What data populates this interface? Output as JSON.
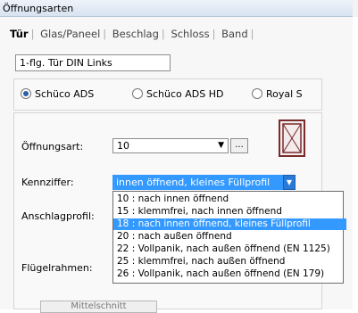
{
  "window": {
    "title": "Öffnungsarten"
  },
  "tabs": [
    {
      "label": "Tür",
      "active": true
    },
    {
      "label": "Glas/Paneel",
      "active": false
    },
    {
      "label": "Beschlag",
      "active": false
    },
    {
      "label": "Schloss",
      "active": false
    },
    {
      "label": "Band",
      "active": false
    }
  ],
  "door_type": {
    "value": "1-flg. Tür DIN Links"
  },
  "systems": [
    {
      "label": "Schüco ADS",
      "selected": true
    },
    {
      "label": "Schüco ADS HD",
      "selected": false
    },
    {
      "label": "Royal S",
      "selected": false
    }
  ],
  "form": {
    "oeffnungsart_label": "Öffnungsart:",
    "oeffnungsart_value": "10",
    "ellipsis_label": "...",
    "kennziffer_label": "Kennziffer:",
    "kennziffer_value": "innen öffnend, kleines Füllprofil",
    "anschlagprofil_label": "Anschlagprofil:",
    "fluegelrahmen_label": "Flügelrahmen:",
    "mittelschnitt_label": "Mittelschnitt"
  },
  "kennziffer_options": [
    {
      "label": "10 :  nach innen öffnend",
      "selected": false
    },
    {
      "label": "15 :  klemmfrei, nach innen öffnend",
      "selected": false
    },
    {
      "label": "18 :  nach innen öffnend, kleines Füllprofil",
      "selected": true
    },
    {
      "label": "20 :  nach außen öffnend",
      "selected": false
    },
    {
      "label": "22 :  Vollpanik, nach außen öffnend (EN 1125)",
      "selected": false
    },
    {
      "label": "25 :  klemmfrei, nach außen öffnend",
      "selected": false
    },
    {
      "label": "26 :  Vollpanik, nach außen öffnend (EN 179)",
      "selected": false
    }
  ],
  "colors": {
    "accent": "#3399ff",
    "door_frame": "#7a2b2b"
  }
}
